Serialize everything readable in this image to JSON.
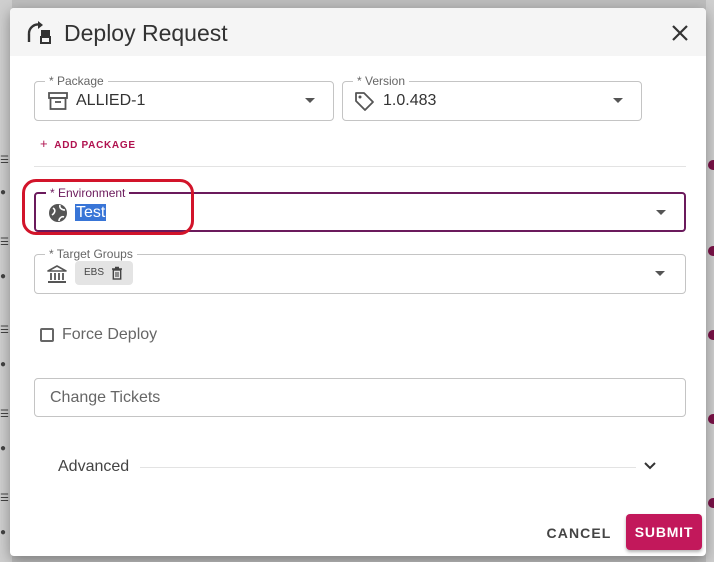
{
  "dialog": {
    "title": "Deploy Request",
    "title_icon": "deploy-swap-icon",
    "close_icon": "close-icon"
  },
  "package": {
    "label": "* Package",
    "value": "ALLIED-1",
    "icon": "archive-box-icon"
  },
  "version": {
    "label": "* Version",
    "value": "1.0.483",
    "icon": "tag-icon"
  },
  "add_package": {
    "label": "ADD PACKAGE"
  },
  "environment": {
    "label": "* Environment",
    "value": "Test",
    "icon": "globe-icon",
    "focused": true,
    "text_selected": true
  },
  "target_groups": {
    "label": "* Target Groups",
    "icon": "bank-icon",
    "chips": [
      {
        "label": "EBS",
        "icon": "trash-icon"
      }
    ]
  },
  "force_deploy": {
    "label": "Force Deploy",
    "checked": false
  },
  "change_tickets": {
    "placeholder": "Change Tickets"
  },
  "advanced": {
    "label": "Advanced",
    "expanded": false
  },
  "actions": {
    "cancel": "CANCEL",
    "submit": "SUBMIT"
  },
  "colors": {
    "accent": "#c2185b",
    "focus_border": "#6b1a5c",
    "selection": "#3875d7",
    "annotation": "#d2142a",
    "header_bg": "#f5f5f5"
  }
}
